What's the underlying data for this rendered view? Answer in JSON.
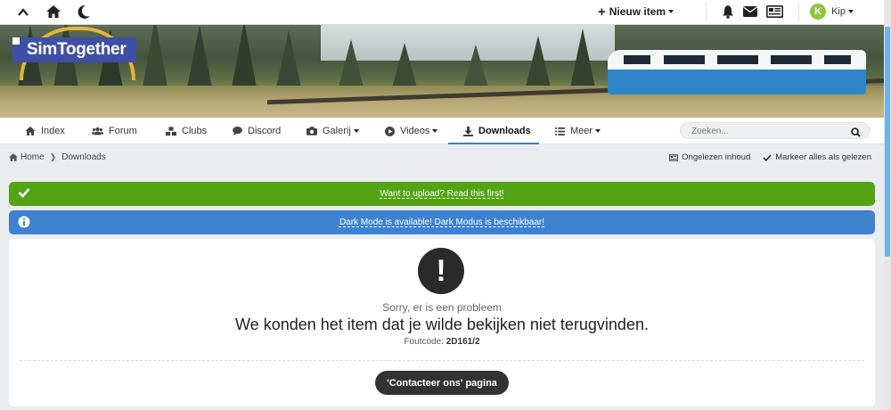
{
  "topbar": {
    "new_item_label": "Nieuw item",
    "new_item_icon": "plus-icon",
    "user": {
      "initial": "K",
      "name": "Kip"
    }
  },
  "brand": {
    "logo_text": "SimTogether"
  },
  "nav": {
    "items": [
      {
        "label": "Index",
        "icon": "home-icon"
      },
      {
        "label": "Forum",
        "icon": "users-icon"
      },
      {
        "label": "Clubs",
        "icon": "cubes-icon"
      },
      {
        "label": "Discord",
        "icon": "chat-icon"
      },
      {
        "label": "Galerij",
        "icon": "camera-icon"
      },
      {
        "label": "Videos",
        "icon": "play-icon"
      },
      {
        "label": "Downloads",
        "icon": "download-icon",
        "active": true
      },
      {
        "label": "Meer",
        "icon": "menu-icon"
      }
    ],
    "search_placeholder": "Zoeken..."
  },
  "breadcrumb": {
    "home": "Home",
    "current": "Downloads",
    "unread_label": "Ongelezen inhoud",
    "mark_read_label": "Markeer alles als gelezen"
  },
  "alerts": {
    "upload": "Want to upload? Read this first!",
    "darkmode": "Dark Mode is available! Dark Modus is beschikbaar!"
  },
  "error": {
    "icon_text": "!",
    "subtitle": "Sorry, er is een probleem",
    "title": "We konden het item dat je wilde bekijken niet terugvinden.",
    "code_label": "Foutcode:",
    "code": "2D161/2",
    "contact_button": "'Contacteer ons' pagina"
  },
  "colors": {
    "success": "#53a313",
    "info": "#3e82d0",
    "accent": "#3f7ed1",
    "logo_bg": "#3f4fa6"
  }
}
